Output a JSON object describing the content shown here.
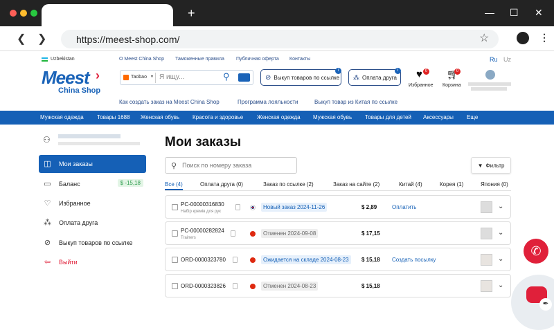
{
  "browser": {
    "url": "https://meest-shop.com/",
    "new_tab": "+",
    "controls": {
      "minimize": "—",
      "maximize": "☐",
      "close": "✕"
    }
  },
  "header": {
    "country": "Uzbekistan",
    "top_links": [
      "О Meest China Shop",
      "Таможенные правила",
      "Публичная оферта",
      "Контакты"
    ],
    "lang_active": "Ru",
    "lang_other": "Uz",
    "logo_main": "Meest",
    "logo_sub": "China Shop",
    "search_source": "Taobao",
    "search_placeholder": "Я ищу...",
    "buy_by_link": "Выкуп товаров по ссылке",
    "buy_by_link_badge": "i",
    "pay_friend": "Оплата друга",
    "pay_friend_badge": "i",
    "favorites": "Избранное",
    "favorites_count": "0",
    "cart": "Корзина",
    "cart_count": "0",
    "sub_links": [
      "Как создать заказ на Meest China Shop",
      "Программа лояльности",
      "Выкуп товар из Китая по ссылке"
    ]
  },
  "categories": [
    "Мужская одежда",
    "Товары 1688",
    "Женская обувь",
    "Красота и здоровье",
    "Женская одежда",
    "Мужская обувь",
    "Товары для детей",
    "Аксессуары",
    "Еще"
  ],
  "sidebar": {
    "items": [
      {
        "label": "Мои заказы",
        "icon": "bag-icon",
        "active": true
      },
      {
        "label": "Баланс",
        "icon": "wallet-icon",
        "value": "$ -15,18"
      },
      {
        "label": "Избранное",
        "icon": "heart-icon"
      },
      {
        "label": "Оплата друга",
        "icon": "users-icon"
      },
      {
        "label": "Выкуп товаров по ссылке",
        "icon": "link-icon"
      },
      {
        "label": "Выйти",
        "icon": "logout-icon"
      }
    ]
  },
  "main": {
    "title": "Мои заказы",
    "search_placeholder": "Поиск по номеру заказа",
    "filter_label": "Фильтр",
    "tabs": [
      "Все (4)",
      "Оплата друга (0)",
      "Заказ по ссылке (2)",
      "Заказ на сайте (2)",
      "Китай (4)",
      "Корея (1)",
      "Япония (0)"
    ],
    "orders": [
      {
        "id": "PC-00000316830",
        "sub": "Набір кремів для рук",
        "status": "Новый заказ 2024-11-26",
        "price": "$ 2,89",
        "action": "Оплатить",
        "flag": "korea",
        "status_color": "#1560b6",
        "status_bg": "#e6f0fb"
      },
      {
        "id": "PC-00000282824",
        "sub": "Trainers",
        "status": "Отменен 2024-09-08",
        "price": "$ 17,15",
        "action": "",
        "flag": "china",
        "status_color": "#666",
        "status_bg": "#eeeeee"
      },
      {
        "id": "ORD-0000323780",
        "sub": "",
        "status": "Ожидается на складе 2024-08-23",
        "price": "$ 15,18",
        "action": "Создать посылку",
        "flag": "china",
        "status_color": "#1560b6",
        "status_bg": "#e6f0fb"
      },
      {
        "id": "ORD-0000323826",
        "sub": "",
        "status": "Отменен 2024-08-23",
        "price": "$ 15,18",
        "action": "",
        "flag": "china",
        "status_color": "#666",
        "status_bg": "#eeeeee"
      }
    ]
  },
  "colors": {
    "brand": "#1560b6",
    "accent_red": "#e0203a"
  }
}
